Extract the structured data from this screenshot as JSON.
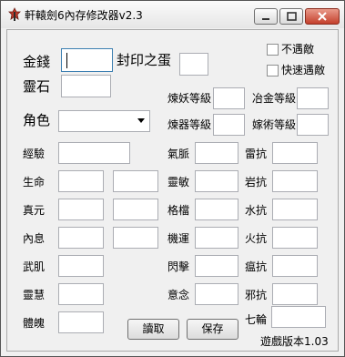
{
  "window": {
    "title": "軒轅劍6內存修改器v2.3"
  },
  "top": {
    "gold_label": "金錢",
    "seal_label": "封印之蛋",
    "spirit_stone_label": "靈石",
    "no_encounter_label": "不遇敵",
    "fast_encounter_label": "快速遇敵",
    "role_label": "角色",
    "role_selected": ""
  },
  "craft": {
    "demon_label": "煉妖等級",
    "smelt_label": "冶金等級",
    "refine_label": "煉器等級",
    "graft_label": "嫁術等級"
  },
  "stats_left": [
    {
      "label": "經驗"
    },
    {
      "label": "生命"
    },
    {
      "label": "真元"
    },
    {
      "label": "內息"
    },
    {
      "label": "武肌"
    },
    {
      "label": "靈慧"
    },
    {
      "label": "體魄"
    }
  ],
  "stats_mid": [
    {
      "label": "氣脈"
    },
    {
      "label": "靈敏"
    },
    {
      "label": "格檔"
    },
    {
      "label": "機運"
    },
    {
      "label": "閃擊"
    },
    {
      "label": "意念"
    }
  ],
  "stats_right": [
    {
      "label": "雷抗"
    },
    {
      "label": "岩抗"
    },
    {
      "label": "水抗"
    },
    {
      "label": "火抗"
    },
    {
      "label": "瘟抗"
    },
    {
      "label": "邪抗"
    },
    {
      "label": "七輪"
    }
  ],
  "buttons": {
    "read_label": "讀取",
    "save_label": "保存"
  },
  "footer": {
    "version_text": "遊戲版本1.03"
  }
}
